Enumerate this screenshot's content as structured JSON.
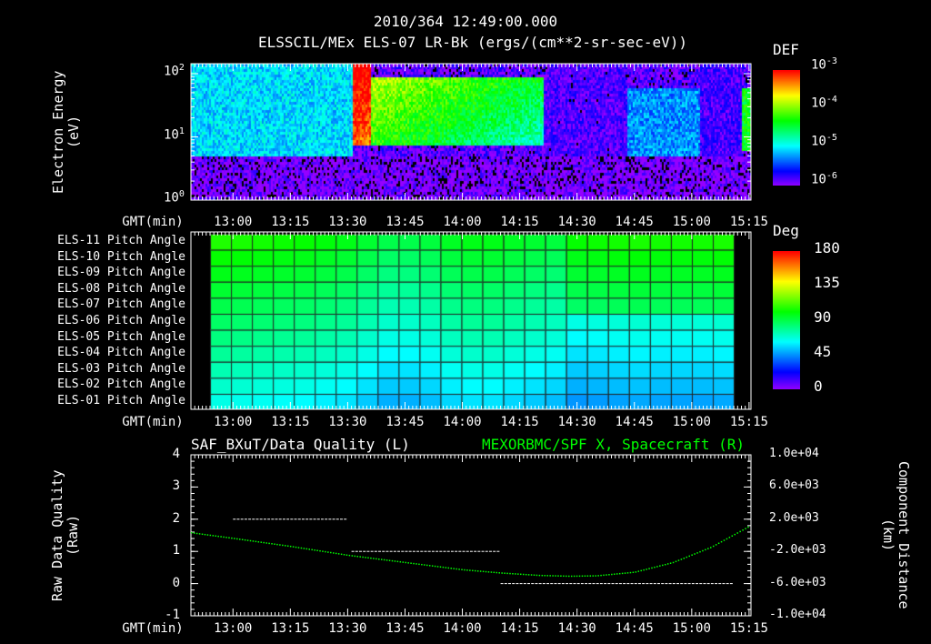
{
  "header": {
    "timestamp": "2010/364 12:49:00.000",
    "title": "ELSSCIL/MEx ELS-07 LR-Bk  (ergs/(cm**2-sr-sec-eV))"
  },
  "time_axis": {
    "label": "GMT(min)",
    "ticks": [
      "13:00",
      "13:15",
      "13:30",
      "13:45",
      "14:00",
      "14:15",
      "14:30",
      "14:45",
      "15:00",
      "15:15"
    ],
    "start_min": 769,
    "end_min": 915.5
  },
  "chart_data": [
    {
      "type": "heatmap",
      "name": "energy-spectrogram",
      "ylabel": "Electron Energy (eV)",
      "yscale": "log",
      "ylim": [
        1,
        145
      ],
      "ytick_labels": [
        {
          "base": "10",
          "exp": "0"
        },
        {
          "base": "10",
          "exp": "1"
        },
        {
          "base": "10",
          "exp": "2"
        }
      ],
      "colorbar": {
        "title": "DEF",
        "scale": "log",
        "range": [
          1e-06,
          0.001
        ],
        "tick_labels": [
          {
            "base": "10",
            "exp": "-3"
          },
          {
            "base": "10",
            "exp": "-4"
          },
          {
            "base": "10",
            "exp": "-5"
          },
          {
            "base": "10",
            "exp": "-6"
          }
        ]
      },
      "segments": [
        {
          "from": "12:49",
          "to": "13:31",
          "peak_log_def": -5.0,
          "band_eV": [
            5,
            145
          ]
        },
        {
          "from": "13:31",
          "to": "13:36",
          "peak_log_def": -3.2,
          "band_eV": [
            8,
            145
          ]
        },
        {
          "from": "13:36",
          "to": "14:21",
          "peak_log_def": -4.1,
          "band_eV": [
            8,
            90
          ]
        },
        {
          "from": "14:21",
          "to": "14:43",
          "peak_log_def": -5.9,
          "band_eV": [
            2,
            145
          ]
        },
        {
          "from": "14:43",
          "to": "15:02",
          "peak_log_def": -5.2,
          "band_eV": [
            5,
            60
          ]
        },
        {
          "from": "15:02",
          "to": "15:13",
          "peak_log_def": -5.8,
          "band_eV": [
            2,
            145
          ]
        },
        {
          "from": "15:13",
          "to": "15:15",
          "peak_log_def": -4.3,
          "band_eV": [
            6,
            60
          ]
        }
      ]
    },
    {
      "type": "heatmap",
      "name": "pitch-angle",
      "rows": [
        "ELS-11 Pitch Angle",
        "ELS-10 Pitch Angle",
        "ELS-09 Pitch Angle",
        "ELS-08 Pitch Angle",
        "ELS-07 Pitch Angle",
        "ELS-06 Pitch Angle",
        "ELS-05 Pitch Angle",
        "ELS-04 Pitch Angle",
        "ELS-03 Pitch Angle",
        "ELS-02 Pitch Angle",
        "ELS-01 Pitch Angle"
      ],
      "colorbar": {
        "title": "Deg",
        "range": [
          0,
          180
        ],
        "tick_labels": [
          "180",
          "135",
          "90",
          "45",
          "0"
        ]
      },
      "column_start": "12:54",
      "column_end": "15:11",
      "column_count": 25,
      "row_offset_deg": [
        28,
        24,
        20,
        16,
        12,
        8,
        4,
        0,
        -4,
        -8,
        -12
      ],
      "column_base_deg": [
        78,
        77,
        76,
        75,
        74,
        72,
        70,
        66,
        62,
        62,
        64,
        68,
        70,
        70,
        68,
        66,
        64,
        64,
        65,
        66,
        67,
        66,
        66,
        66,
        67
      ]
    },
    {
      "type": "line",
      "name": "data-quality",
      "title_left": "SAF_BXuT/Data Quality (L)",
      "title_right": "MEXORBMC/SPF X, Spacecraft (R)",
      "ylabel_left": "Raw Data Quality (Raw)",
      "ylabel_right": "Component Distance (km)",
      "ylim_left": [
        -1,
        4
      ],
      "left_tick_labels": [
        "4",
        "3",
        "2",
        "1",
        "0",
        "-1"
      ],
      "ylim_right": [
        -10000,
        10000
      ],
      "right_tick_labels": [
        "1.0e+04",
        "6.0e+03",
        "2.0e+03",
        "-2.0e+03",
        "-6.0e+03",
        "-1.0e+04"
      ],
      "quality_segments": [
        {
          "from_min": 780,
          "to_min": 810,
          "value": 2
        },
        {
          "from_min": 811,
          "to_min": 850,
          "value": 1
        },
        {
          "from_min": 850,
          "to_min": 911,
          "value": 0
        }
      ],
      "spacecraft_x_km": {
        "t_min": [
          769,
          780,
          795,
          810,
          825,
          840,
          850,
          860,
          868,
          875,
          885,
          895,
          905,
          915
        ],
        "km": [
          400,
          -300,
          -1300,
          -2400,
          -3300,
          -4200,
          -4600,
          -4900,
          -5000,
          -4950,
          -4500,
          -3300,
          -1400,
          1200
        ]
      },
      "series_color": "#00ff00"
    }
  ]
}
